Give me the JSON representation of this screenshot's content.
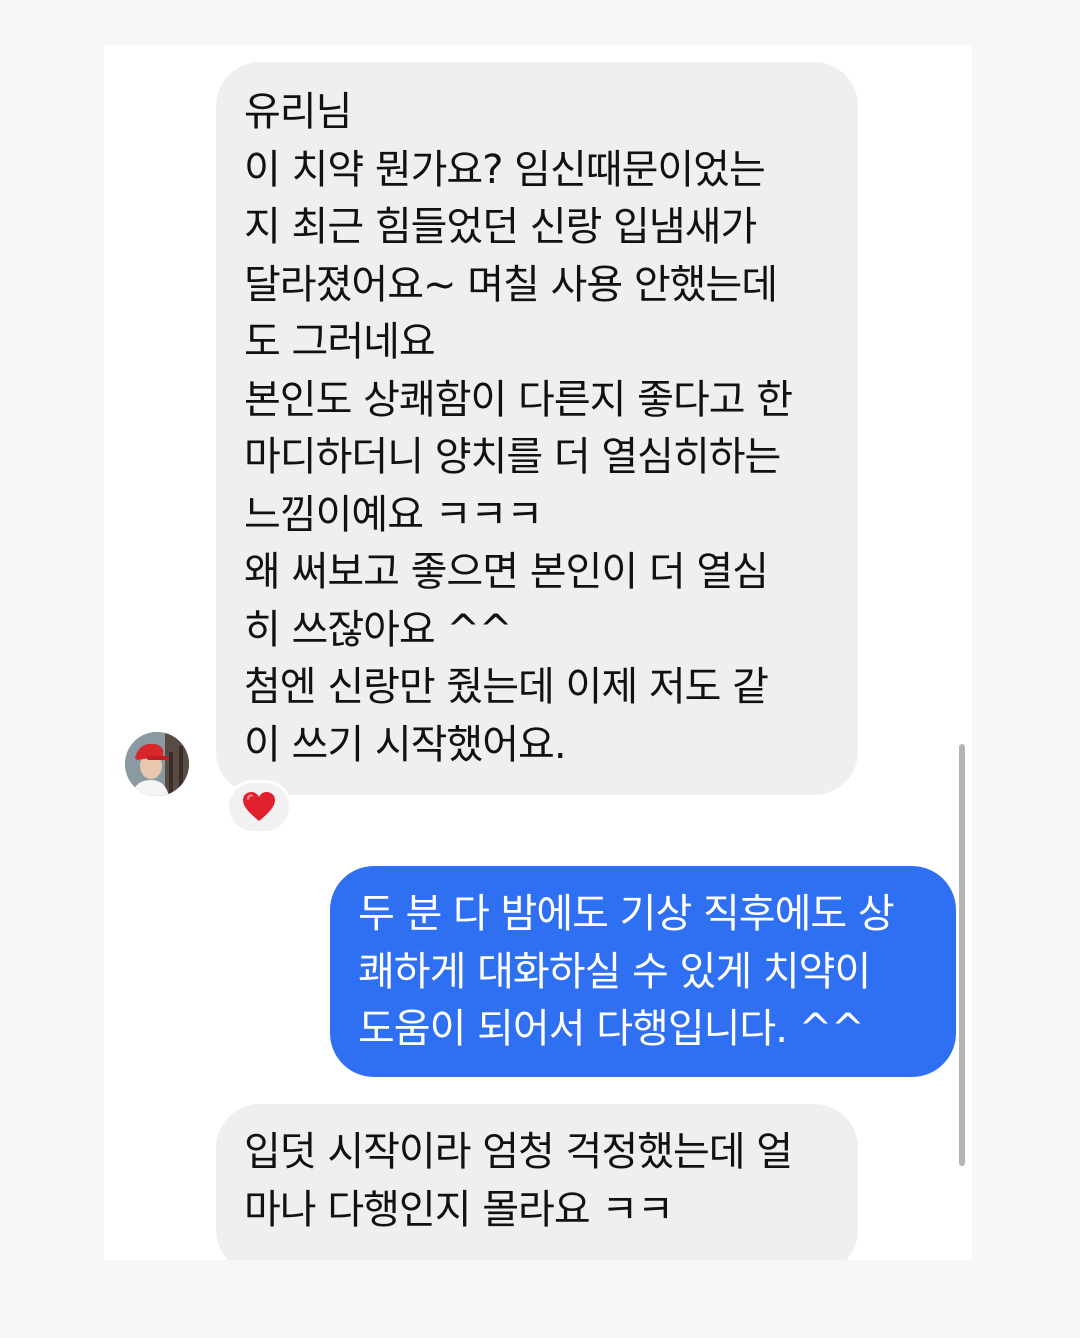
{
  "conversation": {
    "messages": [
      {
        "direction": "incoming",
        "text": "유리님\n이 치약 뭔가요? 임신때문이었는\n지 최근 힘들었던 신랑 입냄새가\n달라졌어요~ 며칠 사용 안했는데\n도 그러네요\n본인도 상쾌함이 다른지 좋다고 한\n마디하더니 양치를 더 열심히하는\n느낌이예요 ㅋㅋㅋ\n왜 써보고 좋으면 본인이 더 열심\n히 쓰잖아요 ^^\n첨엔 신랑만 줬는데 이제 저도 같\n이 쓰기 시작했어요.",
        "reaction": "heart-emoji"
      },
      {
        "direction": "outgoing",
        "text": "두 분 다 밤에도 기상 직후에도 상\n쾌하게 대화하실 수 있게 치약이\n도움이 되어서 다행입니다. ^^"
      },
      {
        "direction": "incoming",
        "text": "입덧 시작이라 엄청 걱정했는데 얼\n마나 다행인지 몰라요 ㅋㅋ"
      }
    ]
  },
  "colors": {
    "incoming_bubble": "#efeff1",
    "outgoing_bubble": "#2f6ff2",
    "outgoing_text": "#ffffff",
    "reaction_heart": "#e0202a"
  }
}
